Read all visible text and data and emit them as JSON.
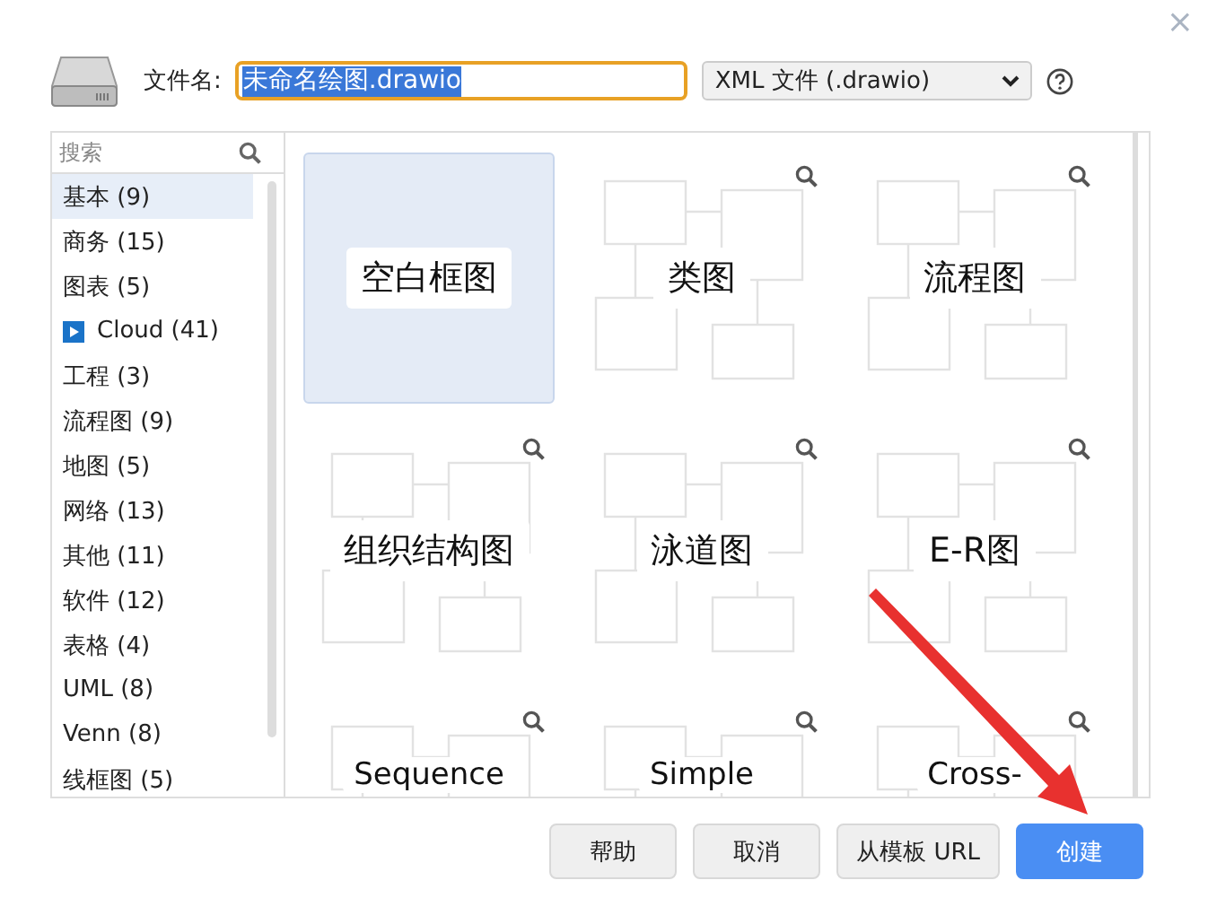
{
  "close": "×",
  "file": {
    "label": "文件名:",
    "value": "未命名绘图.drawio",
    "format": "XML 文件 (.drawio)"
  },
  "sidebar": {
    "search": {
      "placeholder": "搜索"
    },
    "items": [
      {
        "label": "基本 (9)",
        "selected": true,
        "kind": "text"
      },
      {
        "label": "商务 (15)",
        "selected": false,
        "kind": "text"
      },
      {
        "label": "图表 (5)",
        "selected": false,
        "kind": "text"
      },
      {
        "label": "Cloud (41)",
        "selected": false,
        "kind": "collapsed"
      },
      {
        "label": "工程 (3)",
        "selected": false,
        "kind": "text"
      },
      {
        "label": "流程图 (9)",
        "selected": false,
        "kind": "text"
      },
      {
        "label": "地图 (5)",
        "selected": false,
        "kind": "text"
      },
      {
        "label": "网络 (13)",
        "selected": false,
        "kind": "text"
      },
      {
        "label": "其他 (11)",
        "selected": false,
        "kind": "text"
      },
      {
        "label": "软件 (12)",
        "selected": false,
        "kind": "text"
      },
      {
        "label": "表格 (4)",
        "selected": false,
        "kind": "text"
      },
      {
        "label": "UML (8)",
        "selected": false,
        "kind": "text"
      },
      {
        "label": "Venn (8)",
        "selected": false,
        "kind": "text"
      },
      {
        "label": "线框图 (5)",
        "selected": false,
        "kind": "text"
      }
    ]
  },
  "templates": [
    {
      "label": "空白框图",
      "selected": true,
      "kind": "blank"
    },
    {
      "label": "类图",
      "selected": false,
      "kind": "diagram"
    },
    {
      "label": "流程图",
      "selected": false,
      "kind": "diagram"
    },
    {
      "label": "组织结构图",
      "selected": false,
      "kind": "diagram"
    },
    {
      "label": "泳道图",
      "selected": false,
      "kind": "diagram"
    },
    {
      "label": "E-R图",
      "selected": false,
      "kind": "diagram"
    },
    {
      "label": "Sequence",
      "selected": false,
      "kind": "diagram"
    },
    {
      "label": "Simple",
      "selected": false,
      "kind": "diagram"
    },
    {
      "label": "Cross-",
      "selected": false,
      "kind": "diagram"
    }
  ],
  "buttons": [
    {
      "label": "帮助",
      "kind": "normal"
    },
    {
      "label": "取消",
      "kind": "normal"
    },
    {
      "label": "从模板 URL",
      "kind": "normal"
    },
    {
      "label": "创建",
      "kind": "primary"
    }
  ]
}
